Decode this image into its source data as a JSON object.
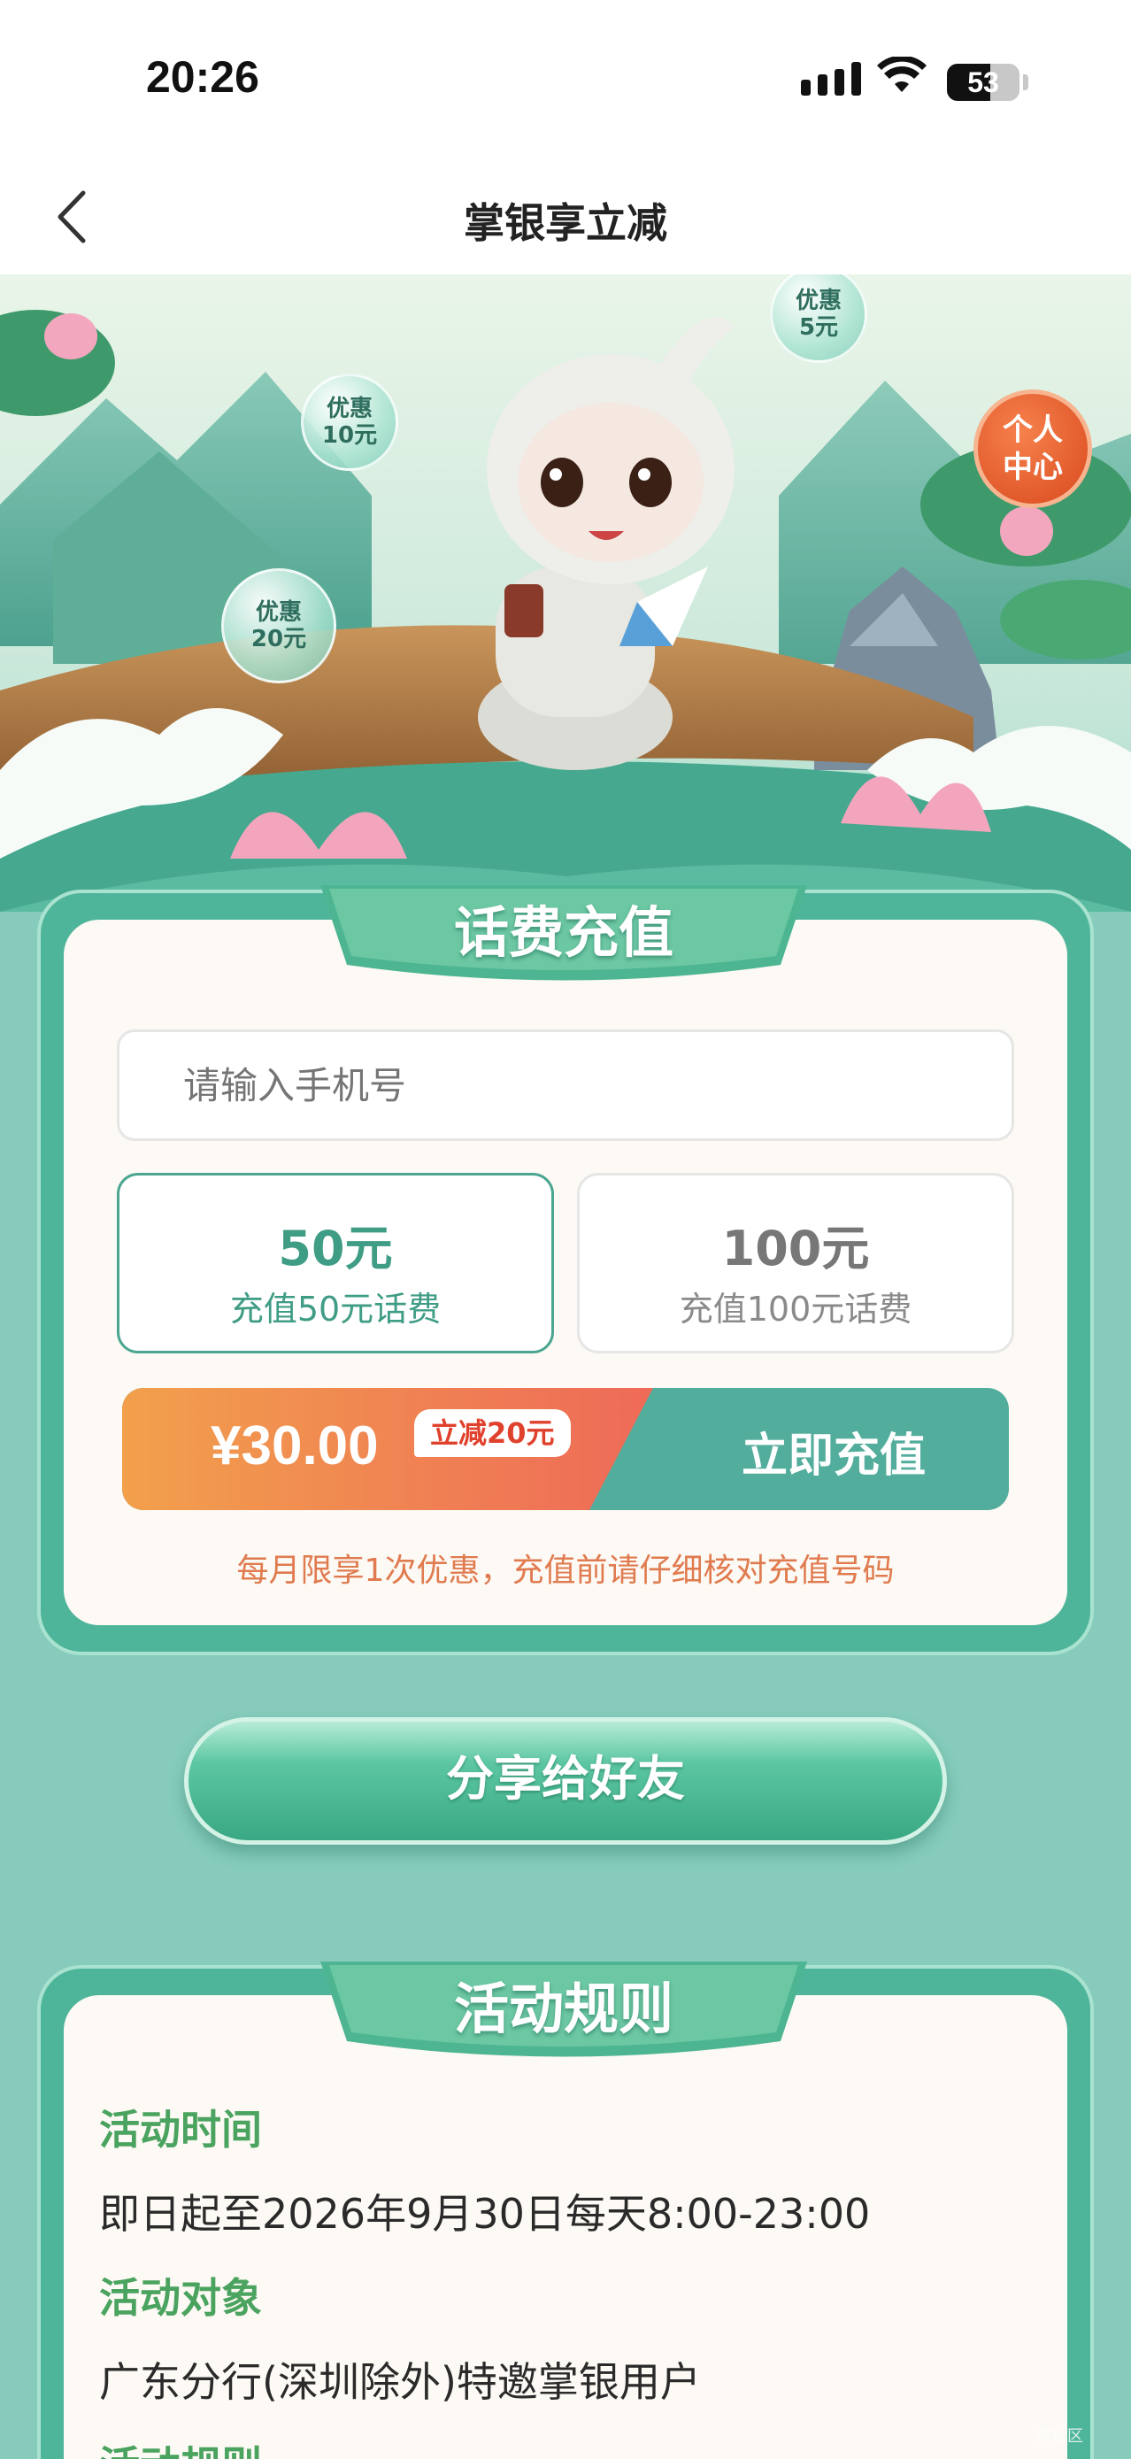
{
  "status": {
    "time": "20:26",
    "battery": "53"
  },
  "nav": {
    "title": "掌银享立减"
  },
  "hero": {
    "bubbles": [
      {
        "line1": "优惠",
        "line2": "5元"
      },
      {
        "line1": "优惠",
        "line2": "10元"
      },
      {
        "line1": "优惠",
        "line2": "20元"
      }
    ],
    "personal_center": {
      "line1": "个人",
      "line2": "中心"
    }
  },
  "recharge": {
    "title": "话费充值",
    "phone_placeholder": "请输入手机号",
    "options": [
      {
        "amount": "50元",
        "desc": "充值50元话费",
        "selected": true
      },
      {
        "amount": "100元",
        "desc": "充值100元话费",
        "selected": false
      }
    ],
    "price": "¥30.00",
    "discount": "立减20元",
    "button": "立即充值",
    "notice": "每月限享1次优惠，充值前请仔细核对充值号码"
  },
  "share": {
    "label": "分享给好友"
  },
  "rules": {
    "title": "活动规则",
    "items": [
      {
        "heading": "活动时间",
        "text": "即日起至2026年9月30日每天8:00-23:00"
      },
      {
        "heading": "活动对象",
        "text": "广东分行(深圳除外)特邀掌银用户"
      },
      {
        "heading": "活动规则"
      }
    ]
  },
  "watermark": "农社区",
  "colors": {
    "primary": "#4fb59a",
    "accent": "#ee6a58",
    "rule_heading": "#4aa35f",
    "page_bg": "#86cbbb"
  }
}
